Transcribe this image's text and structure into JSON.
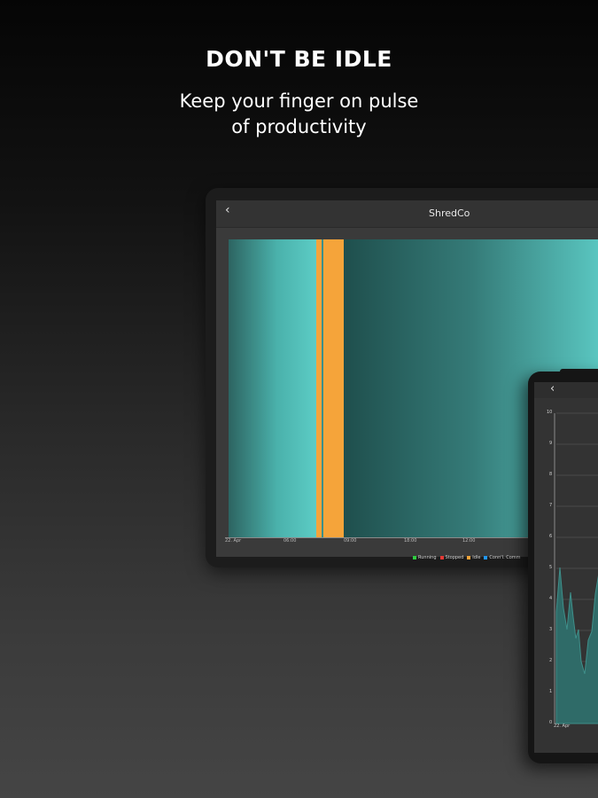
{
  "headline": "DON'T BE IDLE",
  "subtitle": [
    "Keep your finger on pulse",
    "of productivity"
  ],
  "tablet": {
    "back_icon": "back-chevron-icon",
    "title": "ShredCo",
    "x_ticks": [
      "22. Apr",
      "06:00",
      "",
      "09:00",
      "",
      "18:00",
      "",
      "12:00"
    ],
    "legend": [
      {
        "label": "Running",
        "color": "#2ecc40"
      },
      {
        "label": "Stopped",
        "color": "#e53935"
      },
      {
        "label": "Idle",
        "color": "#f5a43a"
      },
      {
        "label": "Conn'l. Comm",
        "color": "#2196f3"
      }
    ]
  },
  "phone": {
    "back_icon": "back-chevron-icon",
    "y_ticks": [
      "10",
      "9",
      "8",
      "7",
      "6",
      "5",
      "4",
      "3",
      "2",
      "1",
      "0"
    ],
    "x_start_label": "22. Apr"
  },
  "colors": {
    "teal": "#5cc8c2",
    "teal_dark": "#1f4f4d",
    "idle": "#f5a43a",
    "background_top": "#050505",
    "background_bottom": "#454545"
  }
}
